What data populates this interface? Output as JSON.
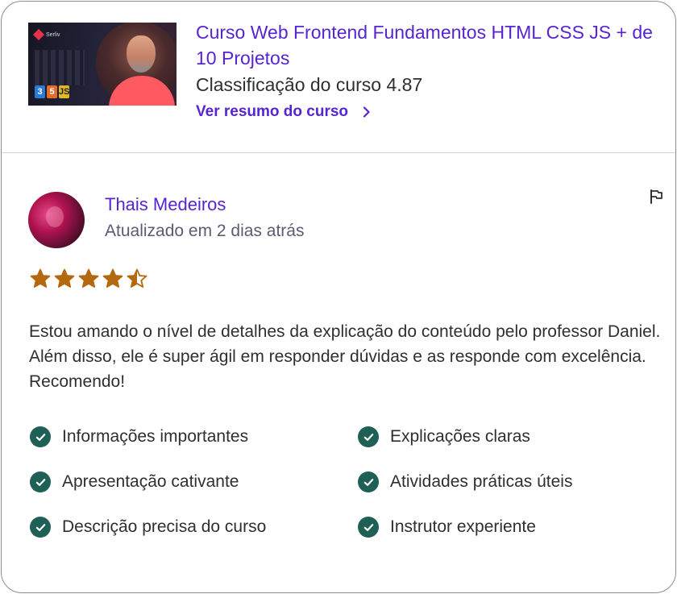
{
  "course": {
    "title": "Curso Web Frontend Fundamentos HTML CSS JS + de 10 Projetos",
    "rating_text": "Classificação do curso 4.87",
    "link_label": "Ver resumo do curso",
    "thumbnail": {
      "brand": "Serliv",
      "badges": [
        "3",
        "5",
        "JS"
      ]
    }
  },
  "review": {
    "reviewer_name": "Thais Medeiros",
    "updated": "Atualizado em 2 dias atrás",
    "rating": 4.5,
    "star_color": "#b4690e",
    "text": "Estou amando o nível de detalhes da explicação do conteúdo pelo professor Daniel. Além disso, ele é super ágil em responder dúvidas e as responde com excelência. Recomendo!",
    "attributes": [
      "Informações importantes",
      "Explicações claras",
      "Apresentação cativante",
      "Atividades práticas úteis",
      "Descrição precisa do curso",
      "Instrutor experiente"
    ]
  },
  "colors": {
    "accent": "#5624d0",
    "check": "#1e6055"
  }
}
